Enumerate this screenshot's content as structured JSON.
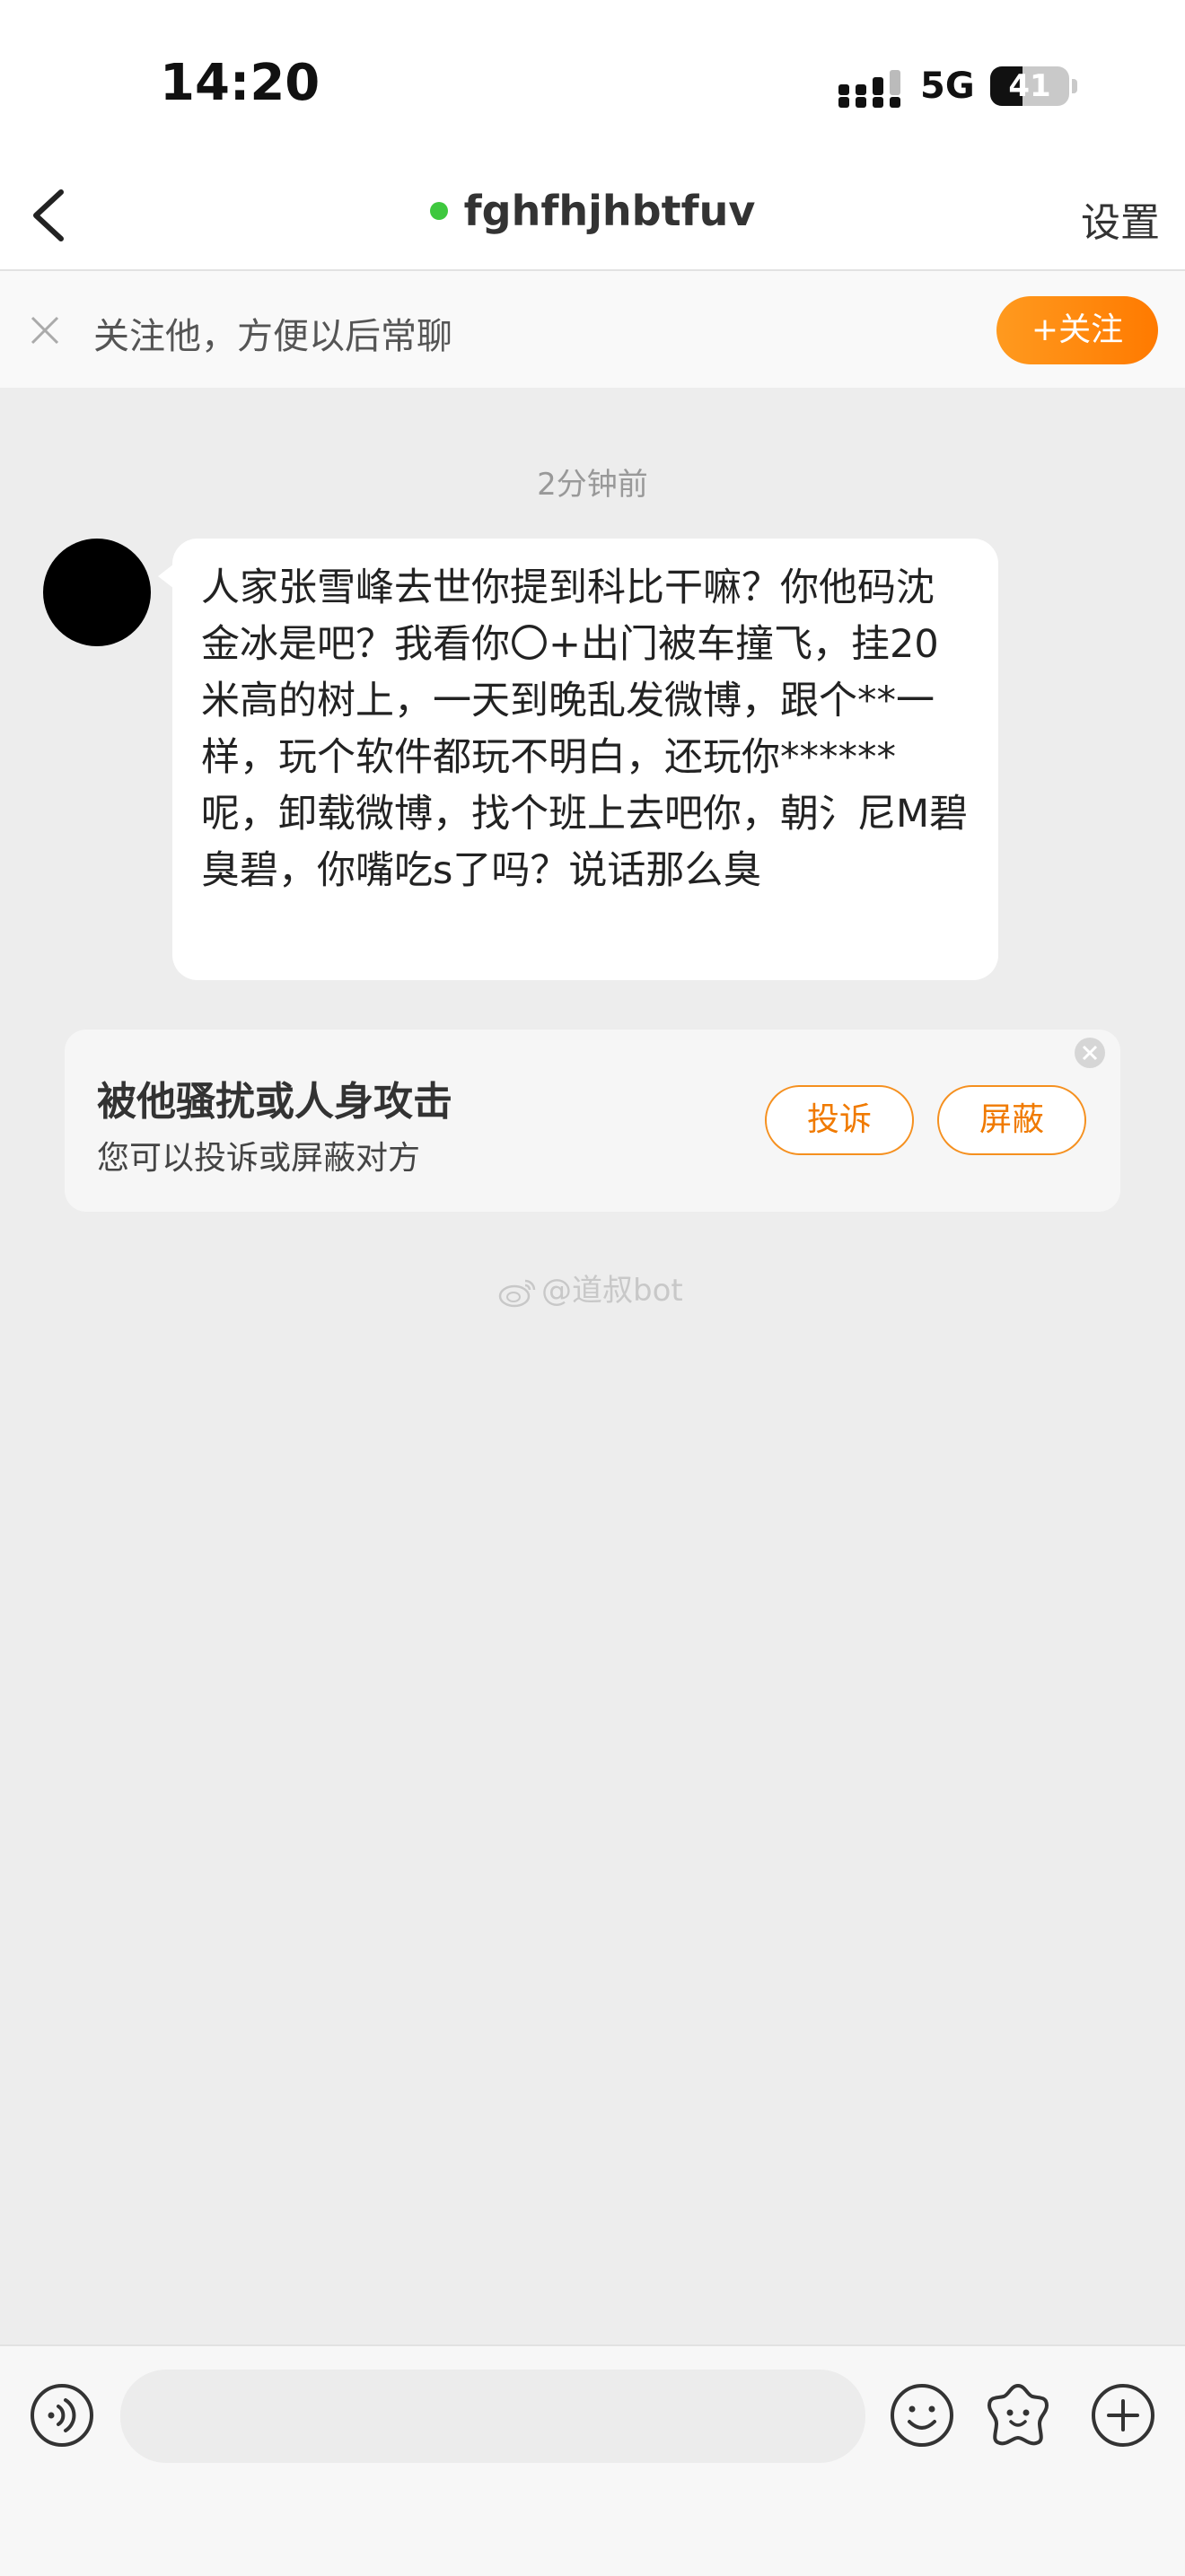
{
  "status_bar": {
    "time": "14:20",
    "network": "5G",
    "battery": "41",
    "battery_level_percent": 41
  },
  "header": {
    "title": "fghfhjhbtfuv",
    "online_status_color": "#3ec83e",
    "settings_label": "设置",
    "back_icon": "chevron-left-icon"
  },
  "follow_bar": {
    "text": "关注他，方便以后常聊",
    "button_label": "+关注",
    "accent_color": "#ff8a00"
  },
  "chat": {
    "timestamp": "2分钟前",
    "message": "人家张雪峰去世你提到科比干嘛？你他码沈金冰是吧？我看你〇+出门被车撞飞，挂20米高的树上，一天到晚乱发微博，跟个**一样，玩个软件都玩不明白，还玩你******呢，卸载微博，找个班上去吧你，朝氵尼M碧臭碧，你嘴吃s了吗？说话那么臭"
  },
  "harassment_card": {
    "title": "被他骚扰或人身攻击",
    "subtitle": "您可以投诉或屏蔽对方",
    "report_label": "投诉",
    "block_label": "屏蔽"
  },
  "watermark": {
    "text": "@道叔bot"
  },
  "input_bar": {
    "placeholder": ""
  }
}
